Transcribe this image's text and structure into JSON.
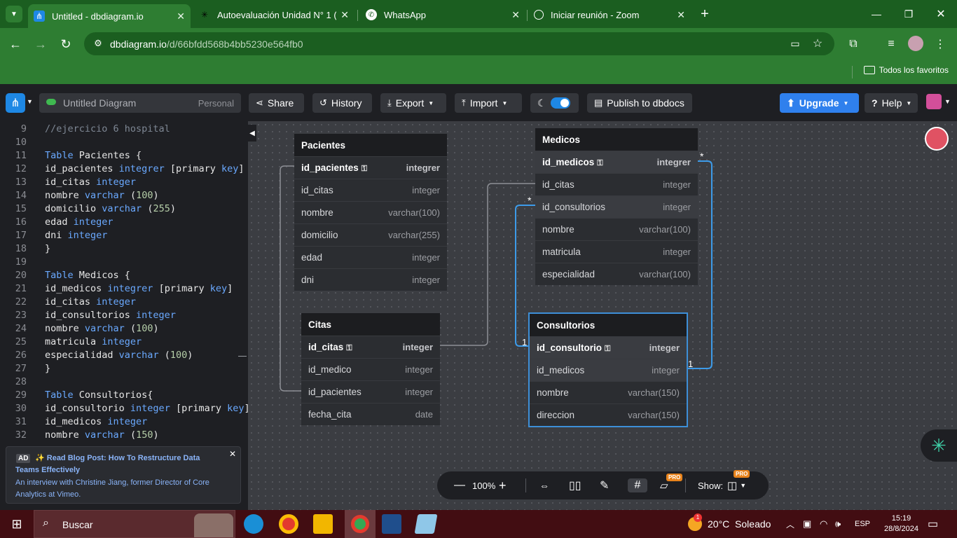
{
  "browser": {
    "tabs": [
      {
        "title": "Untitled - dbdiagram.io",
        "active": true
      },
      {
        "title": "Autoevaluación Unidad N° 1 (P"
      },
      {
        "title": "WhatsApp"
      },
      {
        "title": "Iniciar reunión - Zoom"
      }
    ],
    "url_host": "dbdiagram.io",
    "url_path": "/d/66bfdd568b4bb5230e564fb0",
    "bookmarks_label": "Todos los favoritos"
  },
  "app": {
    "diagram_title": "Untitled Diagram",
    "workspace": "Personal",
    "buttons": {
      "share": "Share",
      "history": "History",
      "export": "Export",
      "import": "Import",
      "publish": "Publish to dbdocs",
      "upgrade": "Upgrade",
      "help": "Help"
    }
  },
  "editor": {
    "lines": [
      {
        "n": "9",
        "text": "//ejercicio 6 hospital"
      },
      {
        "n": "10",
        "text": ""
      },
      {
        "n": "11",
        "text": "Table Pacientes {"
      },
      {
        "n": "12",
        "text": "id_pacientes integrer [primary key]"
      },
      {
        "n": "13",
        "text": "id_citas integer"
      },
      {
        "n": "14",
        "text": "nombre varchar (100)"
      },
      {
        "n": "15",
        "text": "domicilio varchar (255)"
      },
      {
        "n": "16",
        "text": "edad integer"
      },
      {
        "n": "17",
        "text": "dni integer"
      },
      {
        "n": "18",
        "text": "}"
      },
      {
        "n": "19",
        "text": ""
      },
      {
        "n": "20",
        "text": "Table Medicos {"
      },
      {
        "n": "21",
        "text": "id_medicos integrer [primary key]"
      },
      {
        "n": "22",
        "text": "id_citas integer"
      },
      {
        "n": "23",
        "text": "id_consultorios integer"
      },
      {
        "n": "24",
        "text": "nombre varchar (100)"
      },
      {
        "n": "25",
        "text": "matricula integer"
      },
      {
        "n": "26",
        "text": "especialidad varchar (100)"
      },
      {
        "n": "27",
        "text": "}"
      },
      {
        "n": "28",
        "text": ""
      },
      {
        "n": "29",
        "text": "Table Consultorios{"
      },
      {
        "n": "30",
        "text": "id_consultorio integer [primary key]"
      },
      {
        "n": "31",
        "text": "id_medicos integer"
      },
      {
        "n": "32",
        "text": "nombre varchar (150)"
      }
    ]
  },
  "ad": {
    "tag": "AD",
    "headline": "✨ Read Blog Post: How To Restructure Data Teams Effectively",
    "body": "An interview with Christine Jiang, former Director of Core Analytics at Vimeo."
  },
  "tables": {
    "pacientes": {
      "name": "Pacientes",
      "rows": [
        {
          "field": "id_pacientes",
          "type": "integrer",
          "pk": true
        },
        {
          "field": "id_citas",
          "type": "integer"
        },
        {
          "field": "nombre",
          "type": "varchar(100)"
        },
        {
          "field": "domicilio",
          "type": "varchar(255)"
        },
        {
          "field": "edad",
          "type": "integer"
        },
        {
          "field": "dni",
          "type": "integer"
        }
      ]
    },
    "citas": {
      "name": "Citas",
      "rows": [
        {
          "field": "id_citas",
          "type": "integer",
          "pk": true
        },
        {
          "field": "id_medico",
          "type": "integer"
        },
        {
          "field": "id_pacientes",
          "type": "integer"
        },
        {
          "field": "fecha_cita",
          "type": "date"
        }
      ]
    },
    "medicos": {
      "name": "Medicos",
      "rows": [
        {
          "field": "id_medicos",
          "type": "integrer",
          "pk": true
        },
        {
          "field": "id_citas",
          "type": "integer"
        },
        {
          "field": "id_consultorios",
          "type": "integer"
        },
        {
          "field": "nombre",
          "type": "varchar(100)"
        },
        {
          "field": "matricula",
          "type": "integer"
        },
        {
          "field": "especialidad",
          "type": "varchar(100)"
        }
      ]
    },
    "consultorios": {
      "name": "Consultorios",
      "rows": [
        {
          "field": "id_consultorio",
          "type": "integer",
          "pk": true
        },
        {
          "field": "id_medicos",
          "type": "integer"
        },
        {
          "field": "nombre",
          "type": "varchar(150)"
        },
        {
          "field": "direccion",
          "type": "varchar(150)"
        }
      ]
    }
  },
  "relations": {
    "many": "*",
    "one": "1"
  },
  "bottom_toolbar": {
    "zoom": "100%",
    "show_label": "Show:",
    "pro_badge": "PRO"
  },
  "taskbar": {
    "search_placeholder": "Buscar",
    "weather": "20°C  Soleado",
    "weather_badge": "1",
    "language": "ESP",
    "time": "15:19",
    "date": "28/8/2024"
  }
}
